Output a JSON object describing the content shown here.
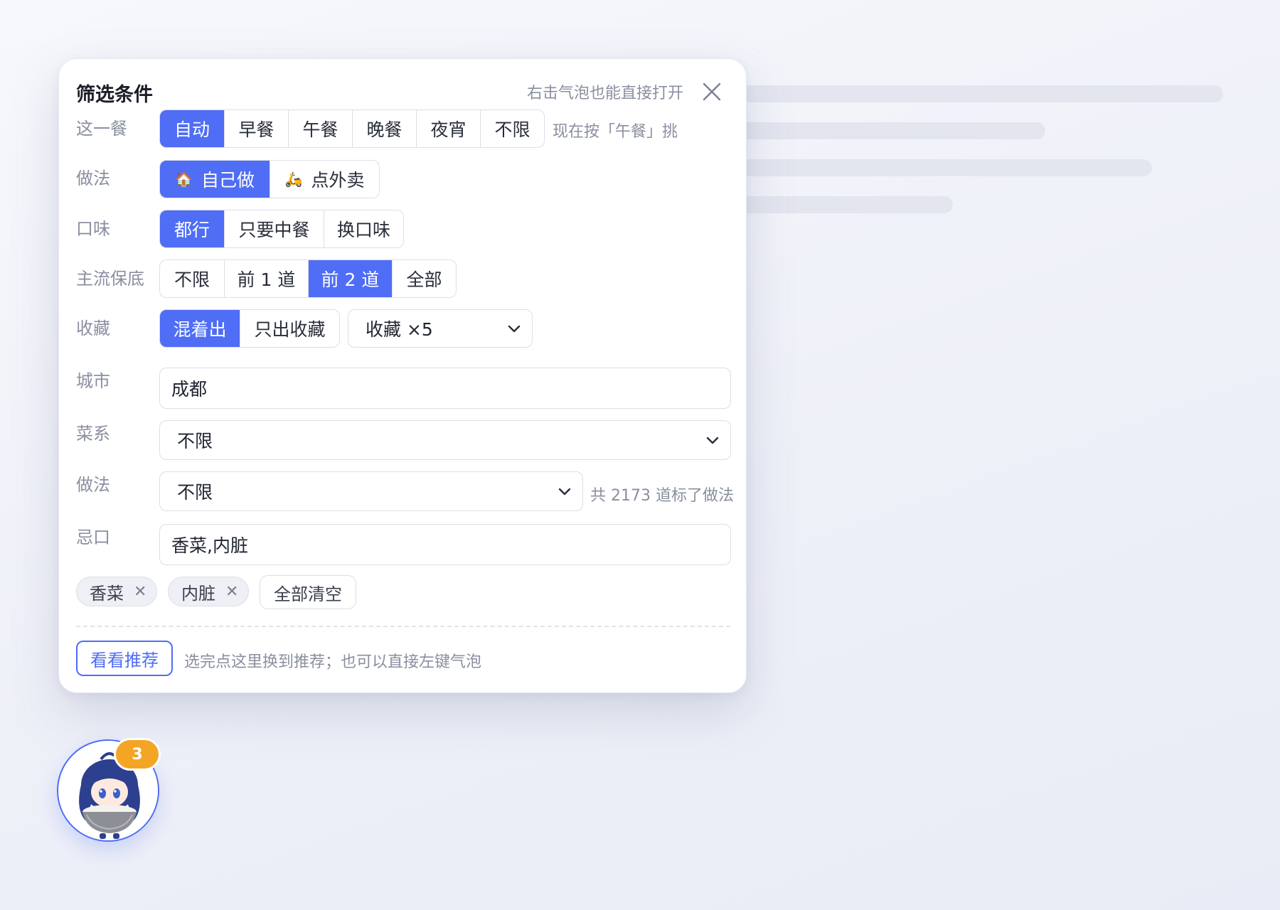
{
  "panel": {
    "title": "筛选条件",
    "top_hint": "右击气泡也能直接打开",
    "icons": {
      "close": "close-icon"
    }
  },
  "meal": {
    "label": "这一餐",
    "options": [
      "自动",
      "早餐",
      "午餐",
      "晚餐",
      "夜宵",
      "不限"
    ],
    "selected": "自动",
    "hint": "现在按「午餐」挑"
  },
  "method_mode": {
    "label": "做法",
    "options": [
      {
        "icon": "house-icon",
        "glyph": "🏠",
        "label": "自己做"
      },
      {
        "icon": "scooter-icon",
        "glyph": "🛵",
        "label": "点外卖"
      }
    ],
    "selected": "自己做"
  },
  "taste": {
    "label": "口味",
    "options": [
      "都行",
      "只要中餐",
      "换口味"
    ],
    "selected": "都行"
  },
  "mainstream": {
    "label": "主流保底",
    "options": [
      "不限",
      "前 1 道",
      "前 2 道",
      "全部"
    ],
    "selected": "前 2 道"
  },
  "favorites": {
    "label": "收藏",
    "options": [
      "混着出",
      "只出收藏"
    ],
    "selected": "混着出",
    "select_value": "收藏 ×5"
  },
  "city": {
    "label": "城市",
    "value": "成都"
  },
  "cuisine": {
    "label": "菜系",
    "value": "不限"
  },
  "cooking": {
    "label": "做法",
    "value": "不限",
    "hint": "共 2173 道标了做法"
  },
  "avoid": {
    "label": "忌口",
    "value": "香菜,内脏",
    "tags": [
      "香菜",
      "内脏"
    ],
    "clear_label": "全部清空"
  },
  "footer": {
    "button_label": "看看推荐",
    "hint": "选完点这里换到推荐；也可以直接左键气泡"
  },
  "floating": {
    "badge_count": "3",
    "avatar": "chibi-rice-bowl-avatar"
  },
  "colors": {
    "accent": "#4f6df5",
    "badge": "#f5a524",
    "muted_text": "#8a8fa0",
    "border": "#dcdfe8"
  }
}
